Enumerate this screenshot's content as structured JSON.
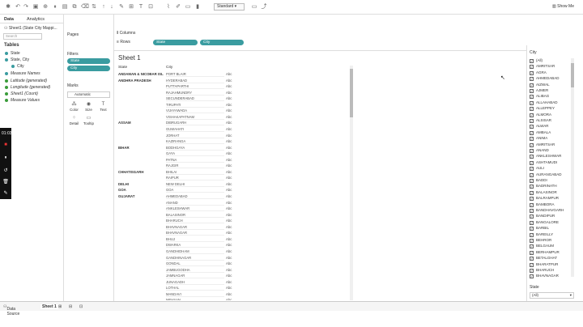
{
  "toolbar": {
    "view_select": "Standard",
    "show_me": "Show Me"
  },
  "left_pane": {
    "tab_data": "Data",
    "tab_analytics": "Analytics",
    "datasource": "Sheet1 (State City Mappi...",
    "search_placeholder": "Search",
    "tables_label": "Tables",
    "fields": [
      {
        "label": "State",
        "color": "#3a9ca0"
      },
      {
        "label": "State, City",
        "color": "#3a9ca0"
      },
      {
        "label": "City",
        "color": "#3a9ca0"
      },
      {
        "label": "Measure Names",
        "color": "#3a9ca0"
      },
      {
        "label": "Latitude (generated)",
        "color": "#3a9c3a"
      },
      {
        "label": "Longitude (generated)",
        "color": "#3a9c3a"
      },
      {
        "label": "Sheet1 (Count)",
        "color": "#3a9c3a"
      },
      {
        "label": "Measure Values",
        "color": "#3a9c3a"
      }
    ]
  },
  "cards": {
    "pages_label": "Pages",
    "filters_label": "Filters",
    "filter_pills": [
      "State",
      "City"
    ],
    "marks_label": "Marks",
    "marks_type": "Automatic",
    "mark_buttons": [
      {
        "label": "Color",
        "icon": "color-icon"
      },
      {
        "label": "Size",
        "icon": "size-icon"
      },
      {
        "label": "Text",
        "icon": "text-icon"
      },
      {
        "label": "Detail",
        "icon": "detail-icon"
      },
      {
        "label": "Tooltip",
        "icon": "tooltip-icon"
      }
    ]
  },
  "shelves": {
    "columns_label": "Columns",
    "rows_label": "Rows",
    "row_pills": [
      "State",
      "City"
    ]
  },
  "sheet": {
    "title": "Sheet 1",
    "col_state": "State",
    "col_city": "City",
    "rows": [
      {
        "state": "ANDAMAN & NICOBAR ISL..",
        "city": "PORT BLAIR",
        "abc": "Abc"
      },
      {
        "state": "ANDHRA PRADESH",
        "city": "HYDERABAD",
        "abc": "Abc"
      },
      {
        "state": "",
        "city": "PUTTAPARTHI",
        "abc": "Abc"
      },
      {
        "state": "",
        "city": "RAJAHMUNDRY",
        "abc": "Abc"
      },
      {
        "state": "",
        "city": "SECUNDERABAD",
        "abc": "Abc"
      },
      {
        "state": "",
        "city": "TIRUPATI",
        "abc": "Abc"
      },
      {
        "state": "",
        "city": "VIJAYAWADA",
        "abc": "Abc"
      },
      {
        "state": "",
        "city": "VISHAKAPATNAM",
        "abc": "Abc"
      },
      {
        "state": "ASSAM",
        "city": "DIBRUGARH",
        "abc": "Abc"
      },
      {
        "state": "",
        "city": "GUWAHATI",
        "abc": "Abc"
      },
      {
        "state": "",
        "city": "JORHAT",
        "abc": "Abc"
      },
      {
        "state": "",
        "city": "KAZIRANGA",
        "abc": "Abc"
      },
      {
        "state": "BIHAR",
        "city": "BODHGAYA",
        "abc": "Abc"
      },
      {
        "state": "",
        "city": "GAYA",
        "abc": "Abc"
      },
      {
        "state": "",
        "city": "PATNA",
        "abc": "Abc"
      },
      {
        "state": "",
        "city": "RAJGIR",
        "abc": "Abc"
      },
      {
        "state": "CHHATISGARH",
        "city": "BHILAI",
        "abc": "Abc"
      },
      {
        "state": "",
        "city": "RAIPUR",
        "abc": "Abc"
      },
      {
        "state": "DELHI",
        "city": "NEW DELHI",
        "abc": "Abc"
      },
      {
        "state": "GOA",
        "city": "GOA",
        "abc": "Abc"
      },
      {
        "state": "GUJARAT",
        "city": "AHMEDABAD",
        "abc": "Abc"
      },
      {
        "state": "",
        "city": "ANAND",
        "abc": "Abc"
      },
      {
        "state": "",
        "city": "ANKLESHWAR",
        "abc": "Abc"
      },
      {
        "state": "",
        "city": "BALASINOR",
        "abc": "Abc"
      },
      {
        "state": "",
        "city": "BHARUCH",
        "abc": "Abc"
      },
      {
        "state": "",
        "city": "BHAVNAGAR",
        "abc": "Abc"
      },
      {
        "state": "",
        "city": "BHAVNAGAR",
        "abc": "Abc"
      },
      {
        "state": "",
        "city": "BHUJ",
        "abc": "Abc"
      },
      {
        "state": "",
        "city": "DWARKA",
        "abc": "Abc"
      },
      {
        "state": "",
        "city": "GANDHIDHAM",
        "abc": "Abc"
      },
      {
        "state": "",
        "city": "GANDHINAGAR",
        "abc": "Abc"
      },
      {
        "state": "",
        "city": "GONDAL",
        "abc": "Abc"
      },
      {
        "state": "",
        "city": "JAMBUGODHA",
        "abc": "Abc"
      },
      {
        "state": "",
        "city": "JAMNAGAR",
        "abc": "Abc"
      },
      {
        "state": "",
        "city": "JUNAGADH",
        "abc": "Abc"
      },
      {
        "state": "",
        "city": "LOTHAL",
        "abc": "Abc"
      },
      {
        "state": "",
        "city": "MANDAVI",
        "abc": "Abc"
      },
      {
        "state": "",
        "city": "MEHSAN",
        "abc": "Abc"
      }
    ]
  },
  "city_filter": {
    "title": "City",
    "items": [
      "(All)",
      "AMRITSAR",
      "AGRA",
      "AHMEDABAD",
      "AIZWAL",
      "AJMER",
      "ALIBAG",
      "ALLAHABAD",
      "ALLEPPEY",
      "ALMORA",
      "ALSISAR",
      "ALWAR",
      "AMBALA",
      "ANIMA",
      "AMRITSAR",
      "ANAND",
      "ANKLESHWAR",
      "ASHTAMUDI",
      "AULI",
      "AURANGABAD",
      "BADDI",
      "BADRINATH",
      "BALASINOR",
      "BALRAMPUR",
      "BAMBORA",
      "BANDHAVGARH",
      "BANDIPUR",
      "BANGALORE",
      "BARBIL",
      "BAREILLY",
      "BEHROR",
      "BELGAUM",
      "BERHAMPUR",
      "BETALGHAT",
      "BHARATPUR",
      "BHARUCH",
      "BHAVNAGAR"
    ],
    "state_label": "State",
    "state_value": "(All)"
  },
  "bottom": {
    "datasource_tab": "Data Source",
    "sheet_tab": "Sheet 1"
  },
  "recorder": {
    "timer": "01:03"
  }
}
